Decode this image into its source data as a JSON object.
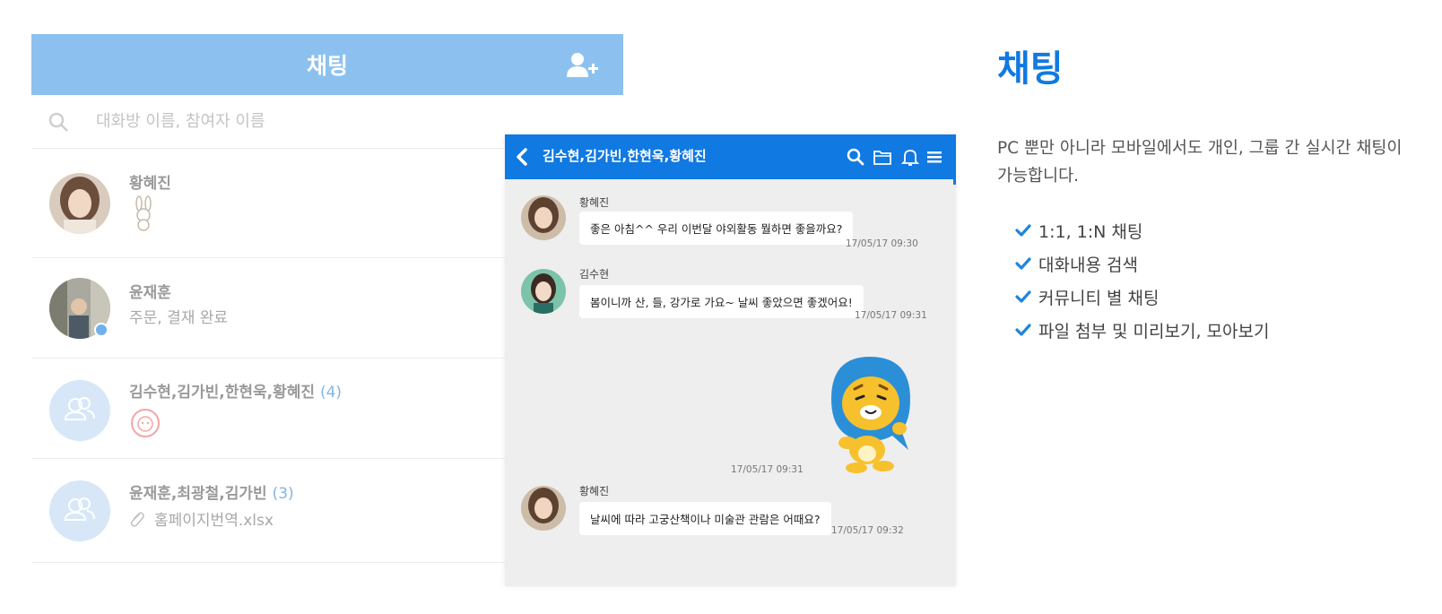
{
  "list": {
    "title": "채팅",
    "search_placeholder": "대화방 이름, 참여자 이름",
    "rooms": [
      {
        "name": "황혜진",
        "preview": ""
      },
      {
        "name": "윤재훈",
        "preview": "주문, 결재 완료"
      },
      {
        "name": "김수현,김가빈,한현욱,황혜진",
        "count": "(4)",
        "preview": ""
      },
      {
        "name": "윤재훈,최광철,김가빈",
        "count": "(3)",
        "preview": "홈페이지번역.xlsx"
      }
    ]
  },
  "chat": {
    "title": "김수현,김가빈,한현욱,황혜진",
    "messages": [
      {
        "sender": "황혜진",
        "text": "좋은 아침^^ 우리 이번달 야외활동 뭘하면 좋을까요?",
        "time": "17/05/17 09:30"
      },
      {
        "sender": "김수현",
        "text": "봄이니까 산, 들, 강가로 가요~ 날씨 좋았으면 좋겠어요!",
        "time": "17/05/17 09:31"
      },
      {
        "sender": "황혜진",
        "text": "날씨에 따라 고궁산책이나 미술관 관람은 어때요?",
        "time": "17/05/17 09:32"
      }
    ],
    "sticker_time": "17/05/17 09:31"
  },
  "description": {
    "title": "채팅",
    "text": "PC 뿐만 아니라 모바일에서도 개인, 그룹 간 실시간 채팅이 가능합니다.",
    "features": [
      "1:1, 1:N 채팅",
      "대화내용 검색",
      "커뮤니티 별 채팅",
      "파일 첨부 및 미리보기, 모아보기"
    ]
  },
  "colors": {
    "list_header": "#8cc1ef",
    "chat_header": "#1079e2",
    "accent": "#1079e2",
    "chat_background": "#eeeeee"
  },
  "icons": [
    "add-user-icon",
    "search-icon",
    "back-icon",
    "folder-icon",
    "bell-icon",
    "menu-icon",
    "check-icon",
    "paperclip-icon",
    "group-icon"
  ]
}
